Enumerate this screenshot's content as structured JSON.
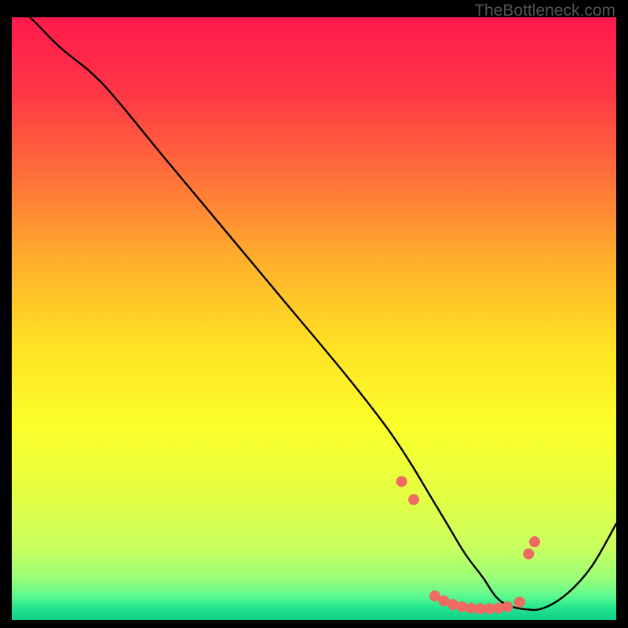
{
  "watermark": "TheBottleneck.com",
  "chart_data": {
    "type": "line",
    "title": "",
    "xlabel": "",
    "ylabel": "",
    "xlim": [
      0,
      100
    ],
    "ylim": [
      0,
      100
    ],
    "background_gradient": {
      "stops": [
        {
          "offset": 0,
          "color": "#ff1a4d"
        },
        {
          "offset": 12,
          "color": "#ff3547"
        },
        {
          "offset": 25,
          "color": "#ff6a3a"
        },
        {
          "offset": 40,
          "color": "#ffae2b"
        },
        {
          "offset": 55,
          "color": "#ffe324"
        },
        {
          "offset": 68,
          "color": "#fbff2a"
        },
        {
          "offset": 80,
          "color": "#e3ff45"
        },
        {
          "offset": 88,
          "color": "#c8ff5e"
        },
        {
          "offset": 93,
          "color": "#9bff78"
        },
        {
          "offset": 96,
          "color": "#5cf98d"
        },
        {
          "offset": 98,
          "color": "#22e58f"
        },
        {
          "offset": 100,
          "color": "#0fcf88"
        }
      ]
    },
    "curve": {
      "x": [
        0,
        3,
        8,
        15,
        25,
        35,
        45,
        55,
        62,
        66,
        69,
        72,
        75,
        78,
        80,
        82,
        85,
        88,
        92,
        96,
        100
      ],
      "y": [
        102,
        100,
        95,
        89,
        77,
        65,
        53,
        41,
        32,
        26,
        21,
        16,
        11,
        7,
        4,
        2.5,
        1.8,
        2.0,
        4.5,
        9,
        16
      ]
    },
    "markers": {
      "x": [
        64.5,
        66.5,
        70.0,
        71.5,
        73.0,
        74.5,
        76.0,
        77.5,
        79.0,
        80.5,
        82.0,
        84.0,
        85.5,
        86.5
      ],
      "y": [
        23.0,
        20.0,
        4.0,
        3.2,
        2.6,
        2.2,
        2.0,
        1.9,
        1.9,
        2.0,
        2.2,
        3.0,
        11.0,
        13.0
      ],
      "color": "#ef6a62",
      "radius": 7
    }
  }
}
